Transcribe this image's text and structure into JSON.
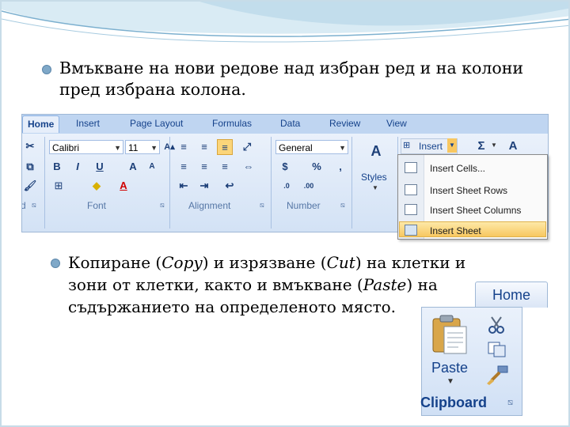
{
  "bullets": {
    "first": "Вмъкване на нови редове над избран ред и на колони пред избрана колона.",
    "second": {
      "part1": "Копиране (",
      "copy": "Copy",
      "part2": ") и изрязване (",
      "cut": "Cut",
      "part3": ") на клетки и зони от клетки, както и вмъкване (",
      "paste": "Paste",
      "part4": ") на съдържанието на определеното място."
    }
  },
  "ribbon": {
    "tabs": [
      "Home",
      "Insert",
      "Page Layout",
      "Formulas",
      "Data",
      "Review",
      "View"
    ],
    "font_name": "Calibri",
    "font_size": "11",
    "number_format": "General",
    "groups": {
      "font": "Font",
      "alignment": "Alignment",
      "number": "Number",
      "styles": "Styles",
      "clipboard_fragment": "d"
    },
    "insert_button": "Insert",
    "sigma": "Σ"
  },
  "insert_menu": {
    "items": [
      "Insert Cells...",
      "Insert Sheet Rows",
      "Insert Sheet Columns",
      "Insert Sheet"
    ],
    "highlighted_index": 3
  },
  "clipboard": {
    "tab": "Home",
    "paste": "Paste",
    "group": "Clipboard"
  },
  "colors": {
    "bullet": "#7fa8c8",
    "ribbon_text": "#15428b",
    "highlight": "#f8c760"
  }
}
